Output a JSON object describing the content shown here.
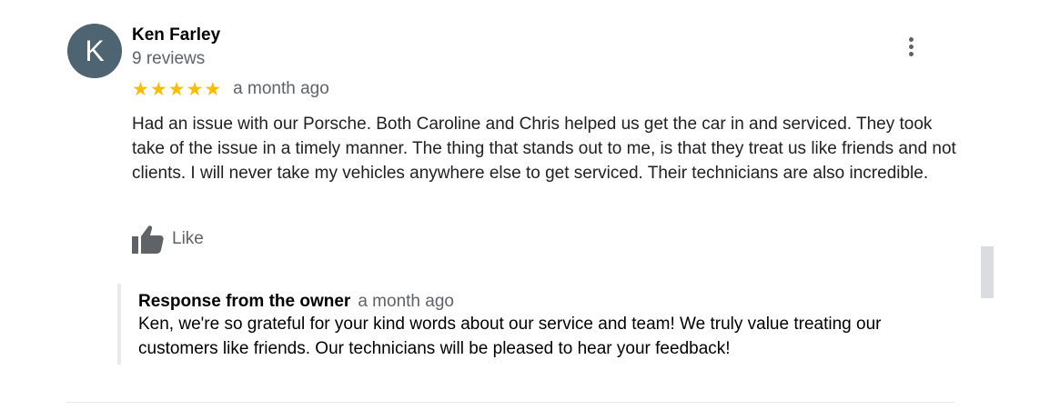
{
  "review": {
    "avatar_initial": "K",
    "author": "Ken Farley",
    "review_count": "9 reviews",
    "rating": 5,
    "stars": [
      "★",
      "★",
      "★",
      "★",
      "★"
    ],
    "date": "a month ago",
    "text": "Had an issue with our Porsche. Both Caroline and Chris helped us get the car in and serviced. They took take of the issue in a timely manner. The thing that stands out to me, is that they treat us like friends and not clients. I will never take my vehicles anywhere else to get serviced. Their technicians are also incredible.",
    "like_label": "Like",
    "more_icon": "more-vert-icon",
    "like_icon": "thumbs-up-icon"
  },
  "owner_response": {
    "title": "Response from the owner",
    "date": "a month ago",
    "text": "Ken, we're so grateful for your kind words about our service and team! We truly value treating our customers like friends. Our technicians will be pleased to hear your feedback!"
  },
  "colors": {
    "avatar_bg": "#4e6472",
    "star": "#fbbc04",
    "secondary_text": "#5f6368",
    "reply_border": "#e8eaed",
    "scrollbar_thumb": "#dadce0"
  }
}
